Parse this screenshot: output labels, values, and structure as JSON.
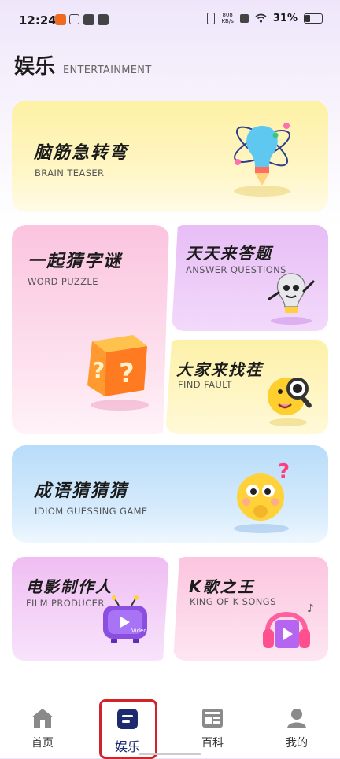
{
  "status_bar": {
    "time": "12:24",
    "net_speed_value": "808",
    "net_speed_unit": "KB/s",
    "battery": "31%"
  },
  "header": {
    "title": "娱乐",
    "subtitle": "ENTERTAINMENT"
  },
  "cards": {
    "brain_teaser": {
      "title": "脑筋急转弯",
      "subtitle": "BRAIN TEASER",
      "icon": "lightbulb-atom-icon"
    },
    "word_puzzle": {
      "title": "一起猜字谜",
      "subtitle": "WORD PUZZLE",
      "icon": "question-box-icon"
    },
    "answer_questions": {
      "title": "天天来答题",
      "subtitle": "ANSWER QUESTIONS",
      "icon": "bulb-character-icon"
    },
    "find_fault": {
      "title": "大家来找茬",
      "subtitle": "FIND FAULT",
      "icon": "magnifier-emoji-icon"
    },
    "idiom": {
      "title": "成语猜猜猜",
      "subtitle": "IDIOM GUESSING GAME",
      "icon": "thinking-emoji-icon"
    },
    "film_producer": {
      "title": "电影制作人",
      "subtitle": "FILM PRODUCER",
      "icon": "tv-video-icon",
      "badge": "Video"
    },
    "k_songs": {
      "title": "K歌之王",
      "subtitle": "KING OF K SONGS",
      "icon": "headphones-icon"
    }
  },
  "bottom_nav": {
    "items": [
      {
        "label": "首页",
        "icon": "home-icon"
      },
      {
        "label": "娱乐",
        "icon": "entertainment-icon",
        "active": true
      },
      {
        "label": "百科",
        "icon": "encyclopedia-icon"
      },
      {
        "label": "我的",
        "icon": "person-icon"
      }
    ]
  },
  "colors": {
    "accent": "#1d2a6e",
    "highlight_box": "#d2232a"
  }
}
